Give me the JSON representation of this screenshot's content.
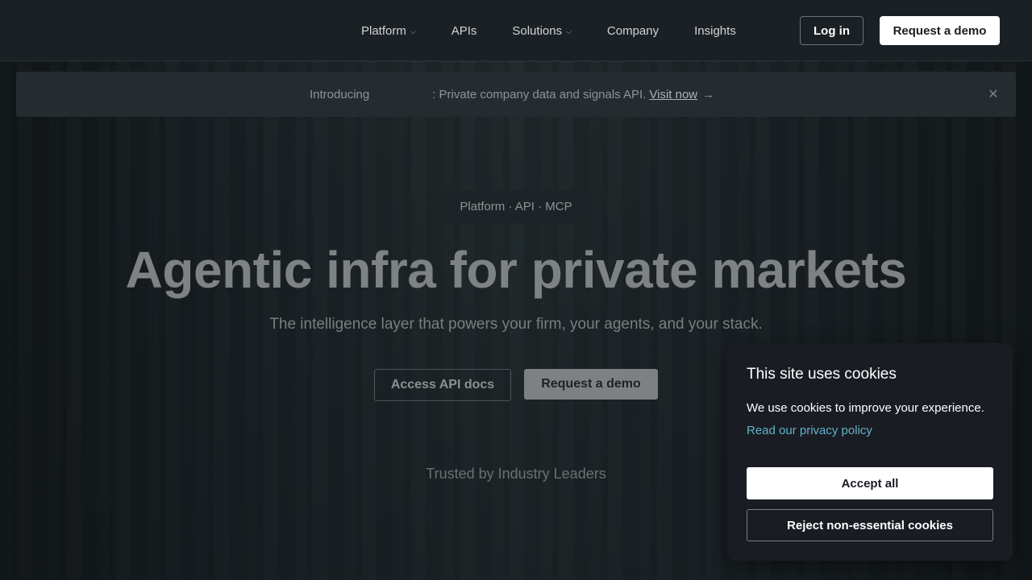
{
  "header": {
    "nav": [
      {
        "label": "Platform",
        "has_dropdown": true
      },
      {
        "label": "APIs",
        "has_dropdown": false
      },
      {
        "label": "Solutions",
        "has_dropdown": true
      },
      {
        "label": "Company",
        "has_dropdown": false
      },
      {
        "label": "Insights",
        "has_dropdown": false
      }
    ],
    "chevron_glyph": "⌵",
    "login_label": "Log in",
    "demo_label": "Request a demo"
  },
  "announcement": {
    "prefix": "Introducing",
    "text": ": Private company data and signals API.",
    "link": "Visit now",
    "arrow": "→",
    "close_glyph": "✕"
  },
  "hero": {
    "pill": "Platform · API · MCP",
    "title": "Agentic infra for private markets",
    "subtitle": "The intelligence layer that powers your firm, your agents, and your stack.",
    "docs_label": "Access API docs",
    "demo_label": "Request a demo",
    "trusted": "Trusted by Industry Leaders"
  },
  "cookie": {
    "title": "This site uses cookies",
    "text": "We use cookies to improve your experience.",
    "link": "Read our privacy policy",
    "accept_label": "Accept all",
    "reject_label": "Reject non-essential cookies"
  },
  "colors": {
    "background": "#1b2327",
    "header": "#1a2024",
    "cookie_panel": "#1a1c24",
    "link_accent": "#5fb4c9"
  }
}
